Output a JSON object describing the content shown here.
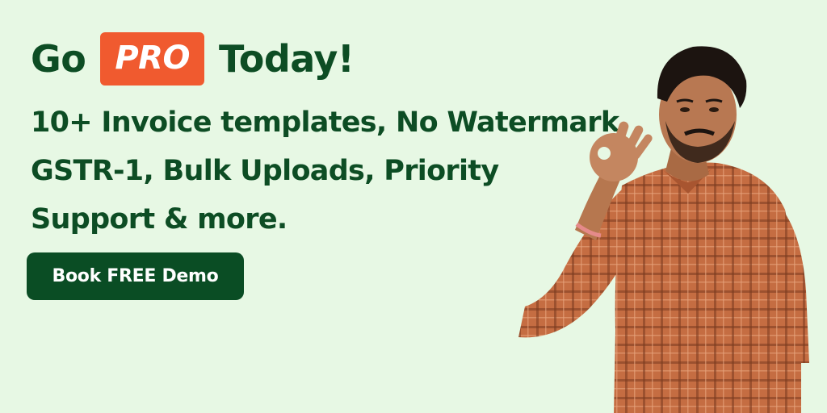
{
  "headline": {
    "prefix": "Go",
    "badge": "PRO",
    "suffix": "Today!"
  },
  "features": {
    "lines": [
      "10+ Invoice templates, No Watermark,",
      "GSTR-1, Bulk Uploads, Priority",
      "Support & more."
    ]
  },
  "cta": {
    "label": "Book FREE Demo"
  },
  "colors": {
    "background": "#e7f8e4",
    "text": "#0d4d24",
    "badge": "#f05a2f",
    "button": "#0a4d24",
    "shirt": "#c26a3f"
  }
}
